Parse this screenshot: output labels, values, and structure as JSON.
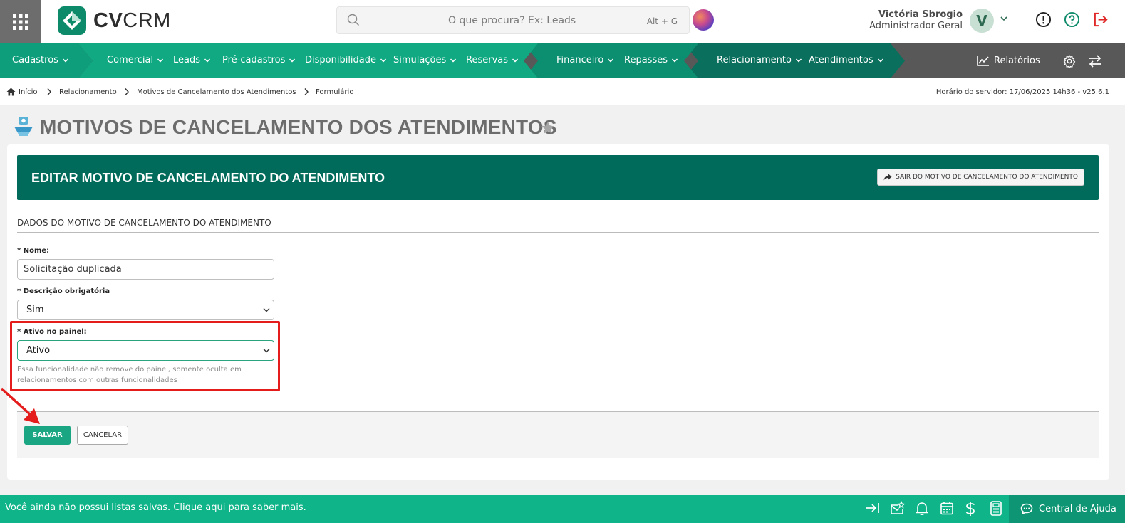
{
  "header": {
    "logo_text_bold": "CV",
    "logo_text_rest": "CRM",
    "search_placeholder": "O que procura? Ex: Leads",
    "search_shortcut": "Alt + G",
    "user_name": "Victória Sbrogio",
    "user_role": "Administrador Geral",
    "avatar_initial": "V",
    "icons": [
      "apps-grid-icon",
      "search-icon",
      "assistant-orb-icon",
      "info-icon",
      "help-icon",
      "logout-icon"
    ]
  },
  "nav": {
    "items": [
      {
        "label": "Cadastros",
        "group": 1
      },
      {
        "label": "Comercial",
        "group": 2
      },
      {
        "label": "Leads",
        "group": 2
      },
      {
        "label": "Pré-cadastros",
        "group": 2
      },
      {
        "label": "Disponibilidade",
        "group": 2
      },
      {
        "label": "Simulações",
        "group": 2
      },
      {
        "label": "Reservas",
        "group": 2
      },
      {
        "label": "Financeiro",
        "group": 3
      },
      {
        "label": "Repasses",
        "group": 3
      },
      {
        "label": "Relacionamento",
        "group": 4
      },
      {
        "label": "Atendimentos",
        "group": 4
      }
    ],
    "reports_label": "Relatórios",
    "colors": {
      "group1": "#0e9e7b",
      "group2": "#11a982",
      "group3": "#0c8f70",
      "group4": "#0a6f5c",
      "rest": "#585858"
    }
  },
  "breadcrumb": {
    "items": [
      "Início",
      "Relacionamento",
      "Motivos de Cancelamento dos Atendimentos",
      "Formulário"
    ],
    "server_time": "Horário do servidor: 17/06/2025 14h36 - v25.6.1"
  },
  "page": {
    "title": "MOTIVOS DE CANCELAMENTO DOS ATENDIMENTOS",
    "banner_title": "EDITAR MOTIVO DE CANCELAMENTO DO ATENDIMENTO",
    "exit_button": "SAIR DO MOTIVO DE CANCELAMENTO DO ATENDIMENTO",
    "section_title": "DADOS DO MOTIVO DE CANCELAMENTO DO ATENDIMENTO"
  },
  "form": {
    "nome_label": "* Nome:",
    "nome_value": "Solicitação duplicada",
    "descricao_label": "* Descrição obrigatória",
    "descricao_value": "Sim",
    "ativo_label": "* Ativo no painel:",
    "ativo_value": "Ativo",
    "ativo_hint": "Essa funcionalidade não remove do painel, somente oculta em relacionamentos com outras funcionalidades",
    "save_label": "SALVAR",
    "cancel_label": "CANCELAR"
  },
  "bottom": {
    "message": "Você ainda não possui listas salvas. Clique aqui para saber mais.",
    "help_label": "Central de Ajuda",
    "icons": [
      "collapse-icon",
      "mail-star-icon",
      "bell-icon",
      "calendar-icon",
      "dollar-icon",
      "calculator-icon",
      "chat-icon"
    ]
  },
  "annotation_color": "#e41c1c"
}
